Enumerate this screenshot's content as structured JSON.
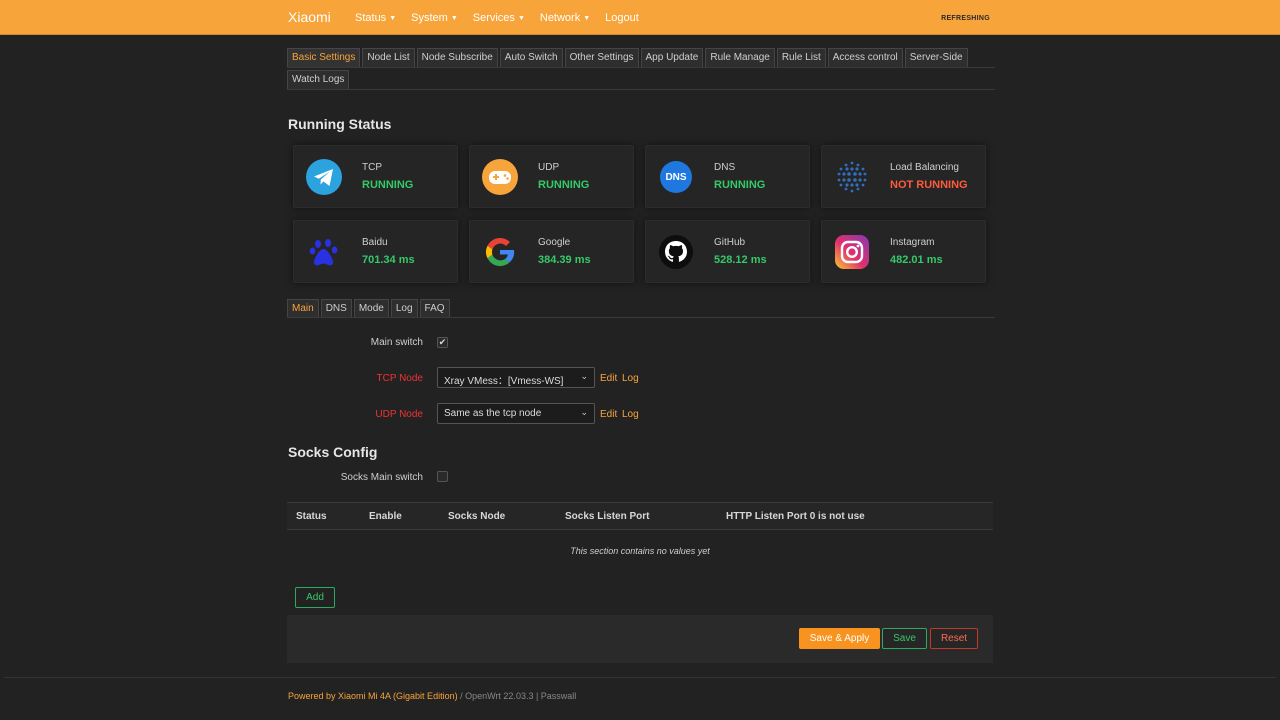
{
  "topbar": {
    "brand": "Xiaomi",
    "menu": [
      {
        "label": "Status",
        "dropdown": true
      },
      {
        "label": "System",
        "dropdown": true
      },
      {
        "label": "Services",
        "dropdown": true
      },
      {
        "label": "Network",
        "dropdown": true
      },
      {
        "label": "Logout",
        "dropdown": false
      }
    ],
    "status": "REFRESHING"
  },
  "tabs": {
    "row1": [
      "Basic Settings",
      "Node List",
      "Node Subscribe",
      "Auto Switch",
      "Other Settings",
      "App Update",
      "Rule Manage",
      "Rule List",
      "Access control",
      "Server-Side"
    ],
    "row2": [
      "Watch Logs"
    ],
    "active": "Basic Settings"
  },
  "running_status": {
    "title": "Running Status",
    "cards": [
      {
        "label": "TCP",
        "value": "RUNNING",
        "state": "ok",
        "icon": "telegram-icon"
      },
      {
        "label": "UDP",
        "value": "RUNNING",
        "state": "ok",
        "icon": "gamepad-icon"
      },
      {
        "label": "DNS",
        "value": "RUNNING",
        "state": "ok",
        "icon": "dns-icon",
        "icon_text": "DNS"
      },
      {
        "label": "Load Balancing",
        "value": "NOT RUNNING",
        "state": "bad",
        "icon": "globe-dots-icon"
      },
      {
        "label": "Baidu",
        "value": "701.34 ms",
        "state": "ok",
        "icon": "baidu-paw-icon"
      },
      {
        "label": "Google",
        "value": "384.39 ms",
        "state": "ok",
        "icon": "google-icon"
      },
      {
        "label": "GitHub",
        "value": "528.12 ms",
        "state": "ok",
        "icon": "github-icon"
      },
      {
        "label": "Instagram",
        "value": "482.01 ms",
        "state": "ok",
        "icon": "instagram-icon"
      }
    ]
  },
  "subtabs": {
    "items": [
      "Main",
      "DNS",
      "Mode",
      "Log",
      "FAQ"
    ],
    "active": "Main"
  },
  "main": {
    "main_switch_label": "Main switch",
    "main_switch_checked": true,
    "tcp_node_label": "TCP Node",
    "tcp_node_value": "Xray VMess：[Vmess-WS]",
    "udp_node_label": "UDP Node",
    "udp_node_value": "Same as the tcp node",
    "edit_label": "Edit",
    "log_label": "Log"
  },
  "socks": {
    "title": "Socks Config",
    "main_switch_label": "Socks Main switch",
    "main_switch_checked": false,
    "columns": [
      "Status",
      "Enable",
      "Socks Node",
      "Socks Listen Port",
      "HTTP Listen Port 0 is not use"
    ],
    "empty_text": "This section contains no values yet",
    "add_label": "Add"
  },
  "actions": {
    "save_apply": "Save & Apply",
    "save": "Save",
    "reset": "Reset"
  },
  "footer": {
    "powered": "Powered by Xiaomi Mi 4A (Gigabit Edition)",
    "rest": " / OpenWrt 22.03.3 | Passwall"
  },
  "colors": {
    "accent": "#f7a43b",
    "ok": "#35c96a",
    "bad": "#ff5a3c"
  }
}
